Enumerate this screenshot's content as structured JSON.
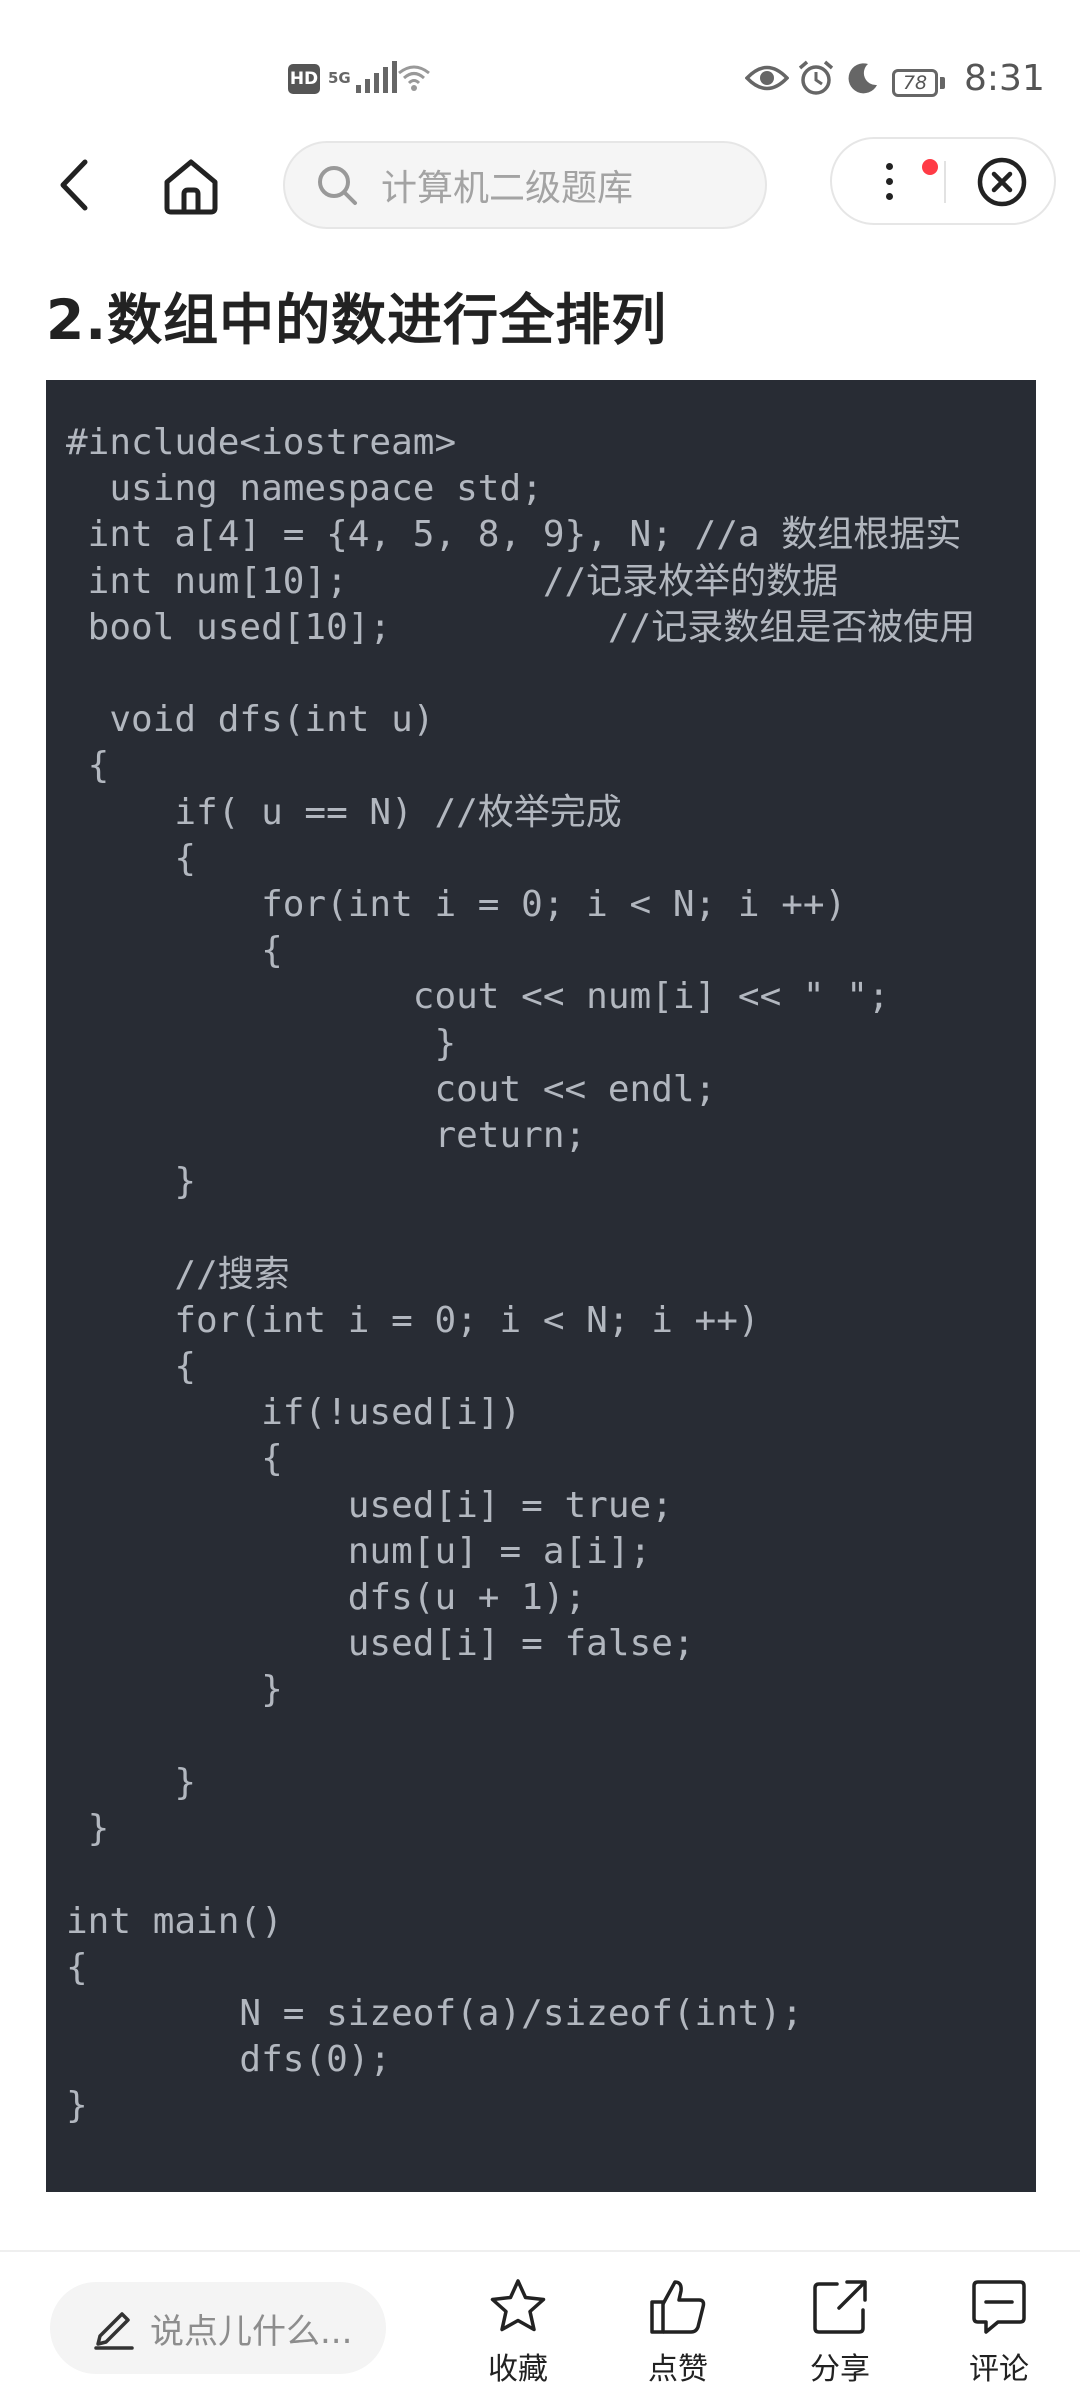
{
  "status_bar": {
    "hd_label": "HD",
    "network_label": "5G",
    "battery": "78",
    "time": "8:31",
    "icons": [
      "signal-icon",
      "wifi-icon",
      "eye-icon",
      "alarm-icon",
      "moon-icon",
      "battery-icon"
    ]
  },
  "nav": {
    "search_placeholder": "计算机二级题库",
    "icons": [
      "back-icon",
      "home-icon",
      "search-icon",
      "more-icon",
      "close-icon"
    ]
  },
  "article": {
    "title": "2.数组中的数进行全排列",
    "code": "#include<iostream>\n  using namespace std;\n int a[4] = {4, 5, 8, 9}, N; //a 数组根据实\n int num[10];         //记录枚举的数据\n bool used[10];          //记录数组是否被使用\n\n  void dfs(int u)\n {\n     if( u == N) //枚举完成\n     {\n         for(int i = 0; i < N; i ++)\n         {\n                cout << num[i] << \" \";\n                 }\n                 cout << endl;\n                 return;\n     }\n\n     //搜索\n     for(int i = 0; i < N; i ++)\n     {\n         if(!used[i])\n         {\n             used[i] = true;\n             num[u] = a[i];\n             dfs(u + 1);\n             used[i] = false;\n         }\n\n     }\n }\n\nint main()\n{\n        N = sizeof(a)/sizeof(int);\n        dfs(0);\n}"
  },
  "bottom_bar": {
    "comment_placeholder": "说点儿什么...",
    "favorite_label": "收藏",
    "like_label": "点赞",
    "share_label": "分享",
    "comment_label": "评论"
  },
  "colors": {
    "code_background": "#282c34",
    "code_text": "#b2b7bf",
    "notification_dot": "#ff3b46"
  }
}
